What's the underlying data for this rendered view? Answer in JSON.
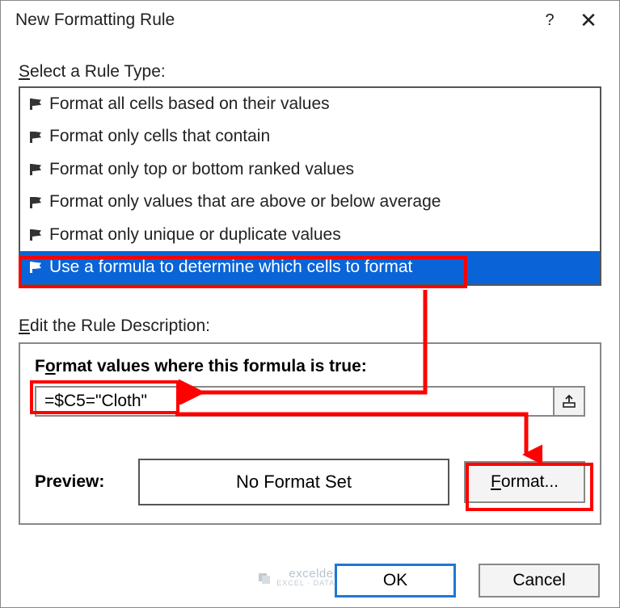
{
  "titlebar": {
    "title": "New Formatting Rule"
  },
  "select_label_prefix": "S",
  "select_label_rest": "elect a Rule Type:",
  "rules": [
    "Format all cells based on their values",
    "Format only cells that contain",
    "Format only top or bottom ranked values",
    "Format only values that are above or below average",
    "Format only unique or duplicate values",
    "Use a formula to determine which cells to format"
  ],
  "edit_label_prefix": "E",
  "edit_label_rest": "dit the Rule Description:",
  "formula_label_before": "F",
  "formula_label_ul": "o",
  "formula_label_after": "rmat values where this formula is true:",
  "formula_value": "=$C5=\"Cloth\"",
  "preview_label": "Preview:",
  "preview_text": "No Format Set",
  "format_btn_ul": "F",
  "format_btn_rest": "ormat...",
  "ok_label": "OK",
  "cancel_label": "Cancel",
  "watermark": "exceldemy",
  "watermark_sub": "EXCEL · DATA · TIPS"
}
